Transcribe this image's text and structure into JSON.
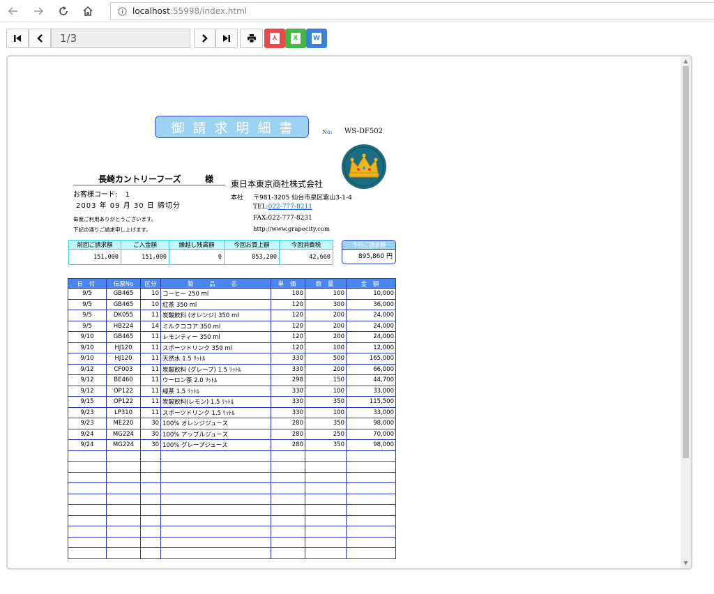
{
  "browser": {
    "url_host": "localhost",
    "url_rest": ":55998/index.html"
  },
  "toolbar": {
    "page_indicator": "1/3",
    "export_pdf_icon": "pdf-icon",
    "export_excel_icon": "excel-icon",
    "export_word_icon": "word-icon",
    "colors": {
      "pdf": "#e84a4a",
      "excel": "#45b749",
      "word": "#3b82d6"
    }
  },
  "report": {
    "title": "御請求明細書",
    "no_label": "No:",
    "doc_no": "WS-DF502",
    "customer_name": "長崎カントリーフーズ",
    "honorific": "様",
    "customer_code_label": "お客様コード:",
    "customer_code": "1",
    "close_date": "2003 年 09 月 30 日 締切分",
    "thanks_line1": "毎度ご利用ありがとうございます。",
    "thanks_line2": "下記の通りご請求申し上げます。",
    "company_name": "東日本東京商社株式会社",
    "address_label": "本社",
    "address": "〒981-3205 仙台市泉区紫山3-1-4",
    "tel_label": "TEL:",
    "tel": "022-777-8211",
    "fax": "FAX:022-777-8231",
    "website": "http://www.grapecity.com",
    "summary_headers": [
      "前回ご請求額",
      "ご入金額",
      "繰越し残高額",
      "今回お買上額",
      "今回消費税"
    ],
    "summary_values": [
      "151,000",
      "151,000",
      "0",
      "853,200",
      "42,660"
    ],
    "billing_label": "今回ご請求額",
    "billing_value": "895,860 円",
    "detail_headers": [
      "日 付",
      "伝票No",
      "区分",
      "製 品 名",
      "単 価",
      "数 量",
      "金 額"
    ],
    "detail_rows": [
      [
        "9/5",
        "GB465",
        "10",
        "コーヒー 250 ml",
        "100",
        "100",
        "10,000"
      ],
      [
        "9/5",
        "GB465",
        "10",
        "紅茶 350 ml",
        "120",
        "300",
        "36,000"
      ],
      [
        "9/5",
        "DK055",
        "11",
        "炭酸飲料 (オレンジ) 350 ml",
        "120",
        "200",
        "24,000"
      ],
      [
        "9/5",
        "HB224",
        "14",
        "ミルクココア 350 ml",
        "120",
        "200",
        "24,000"
      ],
      [
        "9/10",
        "GB465",
        "11",
        "レモンティー 350 ml",
        "120",
        "200",
        "24,000"
      ],
      [
        "9/10",
        "HJ120",
        "11",
        "スポーツドリンク 350 ml",
        "120",
        "100",
        "12,000"
      ],
      [
        "9/10",
        "HJ120",
        "11",
        "天然水 1.5 ﾘｯﾄﾙ",
        "330",
        "500",
        "165,000"
      ],
      [
        "9/12",
        "CF003",
        "11",
        "炭酸飲料 (グレープ) 1.5 ﾘｯﾄﾙ",
        "330",
        "200",
        "66,000"
      ],
      [
        "9/12",
        "BE460",
        "11",
        "ウーロン茶 2.0 ﾘｯﾄﾙ",
        "298",
        "150",
        "44,700"
      ],
      [
        "9/12",
        "OP122",
        "11",
        "緑茶 1.5 ﾘｯﾄﾙ",
        "330",
        "100",
        "33,000"
      ],
      [
        "9/15",
        "OP122",
        "11",
        "炭酸飲料(レモン) 1.5 ﾘｯﾄﾙ",
        "330",
        "350",
        "115,500"
      ],
      [
        "9/23",
        "LP310",
        "11",
        "スポーツドリンク 1.5 ﾘｯﾄﾙ",
        "330",
        "100",
        "33,000"
      ],
      [
        "9/23",
        "ME220",
        "30",
        "100% オレンジジュース",
        "280",
        "350",
        "98,000"
      ],
      [
        "9/24",
        "MG224",
        "30",
        "100% アップルジュース",
        "280",
        "250",
        "70,000"
      ],
      [
        "9/24",
        "MG224",
        "30",
        "100% グレープジュース",
        "280",
        "350",
        "98,000"
      ]
    ],
    "empty_rows": 10
  }
}
